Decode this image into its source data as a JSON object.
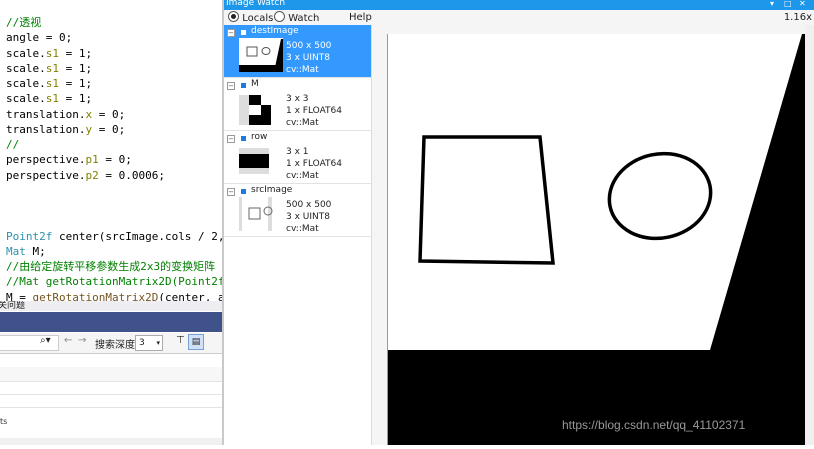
{
  "editor": {
    "code_lines": [
      {
        "parts": [
          {
            "t": "//透视",
            "c": "comment"
          }
        ]
      },
      {
        "parts": [
          {
            "t": "angle = 0;",
            "c": ""
          }
        ]
      },
      {
        "parts": [
          {
            "t": "scale.",
            "c": ""
          },
          {
            "t": "s1",
            "c": "field"
          },
          {
            "t": " = 1;",
            "c": ""
          }
        ]
      },
      {
        "parts": [
          {
            "t": "scale.",
            "c": ""
          },
          {
            "t": "s1",
            "c": "field"
          },
          {
            "t": " = 1;",
            "c": ""
          }
        ]
      },
      {
        "parts": [
          {
            "t": "scale.",
            "c": ""
          },
          {
            "t": "s1",
            "c": "field"
          },
          {
            "t": " = 1;",
            "c": ""
          }
        ]
      },
      {
        "parts": [
          {
            "t": "scale.",
            "c": ""
          },
          {
            "t": "s1",
            "c": "field"
          },
          {
            "t": " = 1;",
            "c": ""
          }
        ]
      },
      {
        "parts": [
          {
            "t": "translation.",
            "c": ""
          },
          {
            "t": "x",
            "c": "field"
          },
          {
            "t": " = 0;",
            "c": ""
          }
        ]
      },
      {
        "parts": [
          {
            "t": "translation.",
            "c": ""
          },
          {
            "t": "y",
            "c": "field"
          },
          {
            "t": " = 0;",
            "c": ""
          }
        ]
      },
      {
        "parts": [
          {
            "t": "//",
            "c": "comment"
          }
        ]
      },
      {
        "parts": [
          {
            "t": "perspective.",
            "c": ""
          },
          {
            "t": "p1",
            "c": "field"
          },
          {
            "t": " = 0;",
            "c": ""
          }
        ]
      },
      {
        "parts": [
          {
            "t": "perspective.",
            "c": ""
          },
          {
            "t": "p2",
            "c": "field"
          },
          {
            "t": " = 0.0006;",
            "c": ""
          }
        ]
      },
      {
        "parts": []
      },
      {
        "parts": []
      },
      {
        "parts": []
      },
      {
        "parts": [
          {
            "t": "Point2f",
            "c": "type"
          },
          {
            "t": " center(srcImage.cols / 2, sr",
            "c": ""
          }
        ]
      },
      {
        "parts": [
          {
            "t": "Mat",
            "c": "type"
          },
          {
            "t": " M;",
            "c": ""
          }
        ]
      },
      {
        "parts": [
          {
            "t": "//由给定旋转平移参数生成2x3的变换矩阵",
            "c": "comment"
          }
        ]
      },
      {
        "parts": [
          {
            "t": "//Mat getRotationMatrix2D(Point2f ce",
            "c": "comment"
          }
        ]
      },
      {
        "parts": [
          {
            "t": "M = ",
            "c": ""
          },
          {
            "t": "getRotationMatrix2D",
            "c": "func"
          },
          {
            "t": "(center, ang",
            "c": ""
          }
        ]
      }
    ],
    "error_list_title": "关问题",
    "search_depth_label": "搜索深度:",
    "search_depth_value": "3",
    "bottom_item": "ts"
  },
  "image_watch": {
    "title": "Image Watch",
    "window_buttons": [
      "▾",
      "□",
      "✕"
    ],
    "radio_locals": "Locals",
    "radio_watch": "Watch",
    "help": "Help",
    "zoom": "1.16x",
    "items": [
      {
        "name": "destImage",
        "size": "500 x 500",
        "channels": "3 x UINT8",
        "type": "cv::Mat",
        "selected": true
      },
      {
        "name": "M",
        "size": "3 x 3",
        "channels": "1 x FLOAT64",
        "type": "cv::Mat",
        "selected": false
      },
      {
        "name": "row",
        "size": "3 x 1",
        "channels": "1 x FLOAT64",
        "type": "cv::Mat",
        "selected": false
      },
      {
        "name": "srcImage",
        "size": "500 x 500",
        "channels": "3 x UINT8",
        "type": "cv::Mat",
        "selected": false
      }
    ]
  },
  "watermark": "https://blog.csdn.net/qq_41102371"
}
